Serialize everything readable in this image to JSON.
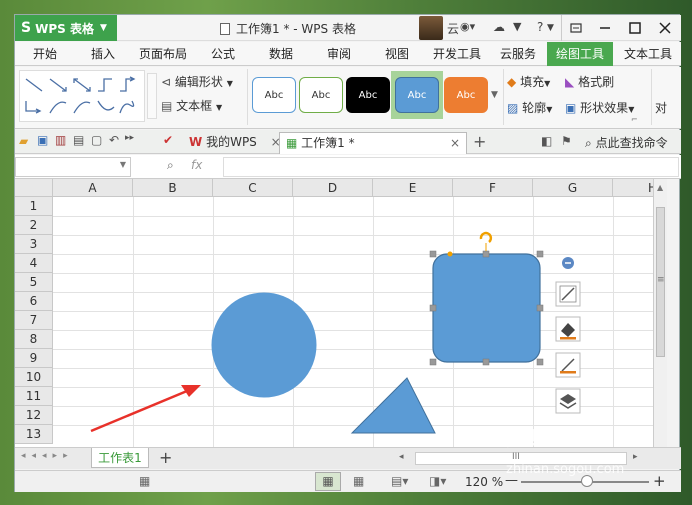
{
  "app": {
    "name": "WPS 表格",
    "logo": "S",
    "window_title": "工作簿1 * - WPS 表格",
    "user_label": "云"
  },
  "titlebar_icons": {
    "cloud": "☁",
    "shirt": "👕",
    "help": "?",
    "restore": "▭",
    "minimize": "—",
    "maximize": "▢",
    "close": "✕"
  },
  "menu": {
    "tabs": [
      "开始",
      "插入",
      "页面布局",
      "公式",
      "数据",
      "审阅",
      "视图",
      "开发工具",
      "云服务",
      "绘图工具",
      "文本工具"
    ],
    "active": "绘图工具"
  },
  "ribbon": {
    "edit_shape": "编辑形状",
    "textbox": "文本框",
    "style_labels": [
      "Abc",
      "Abc",
      "Abc",
      "Abc",
      "Abc"
    ],
    "fill": "填充",
    "format_painter": "格式刷",
    "outline": "轮廓",
    "shape_effects": "形状效果",
    "align": "对"
  },
  "doc_tabs": {
    "my_wps": "我的WPS",
    "workbook": "工作簿1 *",
    "search": "点此查找命令"
  },
  "formula": {
    "fx": "fx",
    "name_box": ""
  },
  "grid": {
    "columns": [
      "A",
      "B",
      "C",
      "D",
      "E",
      "F",
      "G",
      "H"
    ],
    "rows": [
      "1",
      "2",
      "3",
      "4",
      "5",
      "6",
      "7",
      "8",
      "9",
      "10",
      "11",
      "12",
      "13"
    ]
  },
  "sheet": {
    "name": "工作表1",
    "add": "+",
    "scroll_label": "III"
  },
  "status": {
    "zoom": "120 %",
    "minus": "—",
    "plus": "+"
  },
  "watermark": {
    "brand": "搜狗指南",
    "url": "zhinan.sogou.com"
  },
  "colors": {
    "shape_fill": "#5b9bd5",
    "shape_stroke": "#41719c",
    "arrow": "#e8312a",
    "accent_green": "#4aa84f"
  }
}
